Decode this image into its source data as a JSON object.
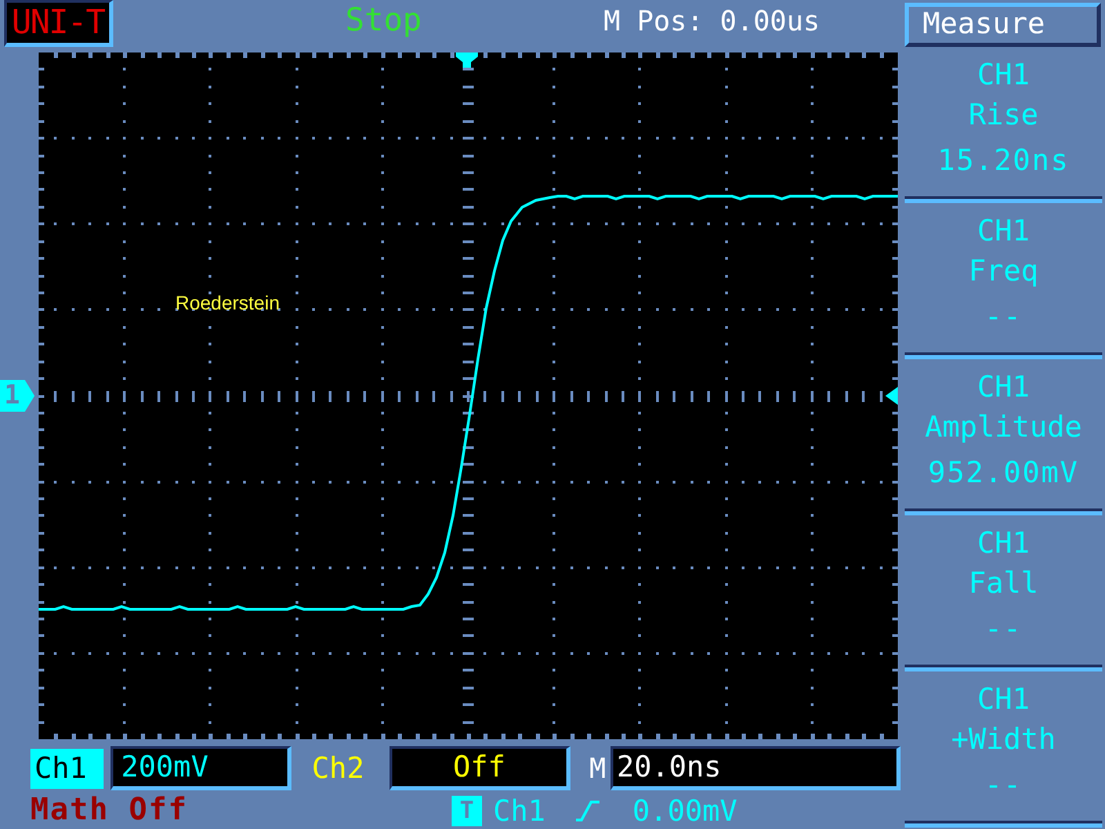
{
  "header": {
    "logo": "UNI-T",
    "run_state": "Stop",
    "position": "M Pos: 0.00us"
  },
  "screen": {
    "channel_marker": "1",
    "annotation": "Roederstein"
  },
  "menu": {
    "title": "Measure",
    "items": [
      {
        "channel": "CH1",
        "measurement": "Rise",
        "value": "15.20ns"
      },
      {
        "channel": "CH1",
        "measurement": "Freq",
        "value": "--"
      },
      {
        "channel": "CH1",
        "measurement": "Amplitude",
        "value": "952.00mV"
      },
      {
        "channel": "CH1",
        "measurement": "Fall",
        "value": "--"
      },
      {
        "channel": "CH1",
        "measurement": "+Width",
        "value": "--"
      }
    ]
  },
  "status_bar": {
    "channels": [
      {
        "label": "Ch1",
        "scale": "200mV",
        "selected": true,
        "color": "#00ffff"
      },
      {
        "label": "Ch2",
        "scale": "Off",
        "selected": false,
        "color": "#ffff00"
      }
    ],
    "timebase": {
      "label": "M",
      "scale": "20.0ns"
    },
    "math": "Math Off",
    "trigger": {
      "badge": "T",
      "source": "Ch1",
      "level": "0.00mV"
    }
  }
}
